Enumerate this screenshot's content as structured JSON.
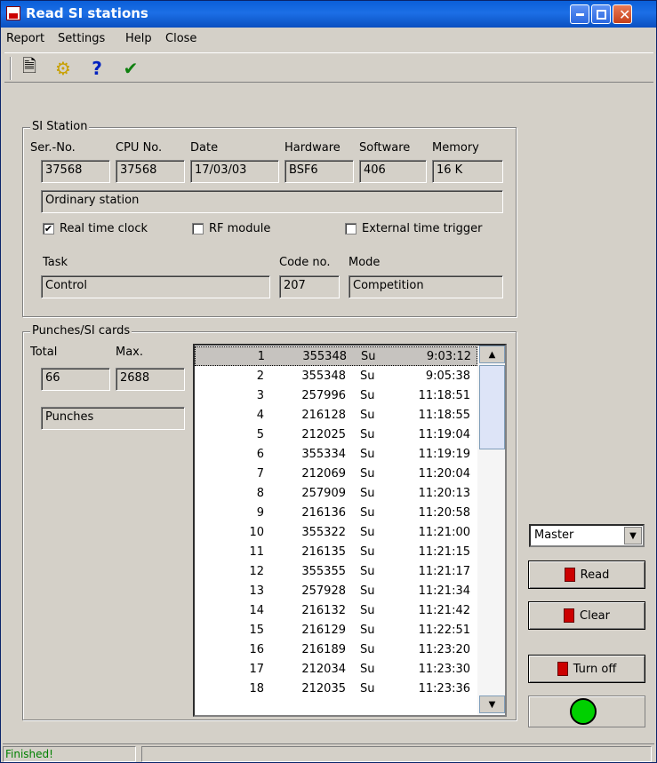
{
  "window": {
    "title": "Read SI stations"
  },
  "menu": [
    "Report",
    "Settings",
    "Help",
    "Close"
  ],
  "toolbar": [
    "report-icon",
    "settings-icon",
    "help-icon",
    "check-icon"
  ],
  "si_station": {
    "group_title": "SI Station",
    "labels": {
      "ser_no": "Ser.-No.",
      "cpu_no": "CPU No.",
      "date": "Date",
      "hardware": "Hardware",
      "software": "Software",
      "memory": "Memory"
    },
    "values": {
      "ser_no": "37568",
      "cpu_no": "37568",
      "date": "17/03/03",
      "hardware": "BSF6",
      "software": "406",
      "memory": "16 K"
    },
    "type": "Ordinary station",
    "checks": [
      {
        "label": "Real time clock",
        "checked": true
      },
      {
        "label": "RF module",
        "checked": false
      },
      {
        "label": "External time trigger",
        "checked": false
      }
    ],
    "task_label": "Task",
    "task": "Control",
    "code_label": "Code no.",
    "code": "207",
    "mode_label": "Mode",
    "mode": "Competition"
  },
  "punches": {
    "group_title": "Punches/SI cards",
    "total_label": "Total",
    "max_label": "Max.",
    "total": "66",
    "max": "2688",
    "kind": "Punches",
    "rows": [
      [
        "1",
        "355348",
        "Su",
        "9:03:12"
      ],
      [
        "2",
        "355348",
        "Su",
        "9:05:38"
      ],
      [
        "3",
        "257996",
        "Su",
        "11:18:51"
      ],
      [
        "4",
        "216128",
        "Su",
        "11:18:55"
      ],
      [
        "5",
        "212025",
        "Su",
        "11:19:04"
      ],
      [
        "6",
        "355334",
        "Su",
        "11:19:19"
      ],
      [
        "7",
        "212069",
        "Su",
        "11:20:04"
      ],
      [
        "8",
        "257909",
        "Su",
        "11:20:13"
      ],
      [
        "9",
        "216136",
        "Su",
        "11:20:58"
      ],
      [
        "10",
        "355322",
        "Su",
        "11:21:00"
      ],
      [
        "11",
        "216135",
        "Su",
        "11:21:15"
      ],
      [
        "12",
        "355355",
        "Su",
        "11:21:17"
      ],
      [
        "13",
        "257928",
        "Su",
        "11:21:34"
      ],
      [
        "14",
        "216132",
        "Su",
        "11:21:42"
      ],
      [
        "15",
        "216129",
        "Su",
        "11:22:51"
      ],
      [
        "16",
        "216189",
        "Su",
        "11:23:20"
      ],
      [
        "17",
        "212034",
        "Su",
        "11:23:30"
      ],
      [
        "18",
        "212035",
        "Su",
        "11:23:36"
      ]
    ]
  },
  "controls": {
    "mode_select": "Master",
    "read": "Read",
    "clear": "Clear",
    "turn_off": "Turn off",
    "led_color": "#00d000"
  },
  "status": {
    "text": "Finished!"
  }
}
